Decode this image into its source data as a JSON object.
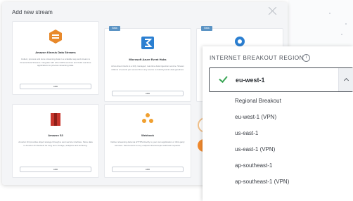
{
  "modal": {
    "title": "Add new stream",
    "cards": [
      {
        "name": "Amazon Kinesis Data Streams",
        "description": "Collect, process and store streaming data in a scalable way and stream to Kinesis Data Streams. Integrate with other AWS services and build real-time applications to process streaming data.",
        "button": "ADD",
        "badge": "",
        "icon": "kinesis-icon",
        "color": "#e8892b"
      },
      {
        "name": "Microsoft Azure Event Hubs",
        "description": "Azure Event Hubs is a fully managed, real-time data ingestion service. Stream millions of events per second from any source to build dynamic data pipelines.",
        "button": "ADD",
        "badge": "Beta",
        "icon": "event-hubs-icon",
        "color": "#2b7fd1"
      },
      {
        "name": "Amazon S3",
        "description": "Amazon S3 provides object storage through a web service interface. Store data in Amazon S3 buckets for long term storage, analytics and archiving.",
        "button": "ADD",
        "badge": "",
        "icon": "s3-icon",
        "color": "#c7352c"
      },
      {
        "name": "Webhook",
        "description": "Deliver streaming data via HTTPS directly to your own application or third-party services. Send events to any endpoint that accepts webhook requests.",
        "button": "ADD",
        "badge": "",
        "icon": "webhook-icon",
        "color": "#f0a030"
      }
    ],
    "third_card_badge": "Beta"
  },
  "dropdown": {
    "label": "INTERNET BREAKOUT REGION",
    "info_glyph": "i",
    "selected": "eu-west-1",
    "options": [
      "Regional Breakout",
      "eu-west-1 (VPN)",
      "us-east-1",
      "us-east-1 (VPN)",
      "ap-southeast-1",
      "ap-southeast-1 (VPN)"
    ]
  },
  "colors": {
    "accent_green": "#3aa655",
    "badge_blue": "#5a93c4",
    "text_dark": "#2c3035"
  }
}
